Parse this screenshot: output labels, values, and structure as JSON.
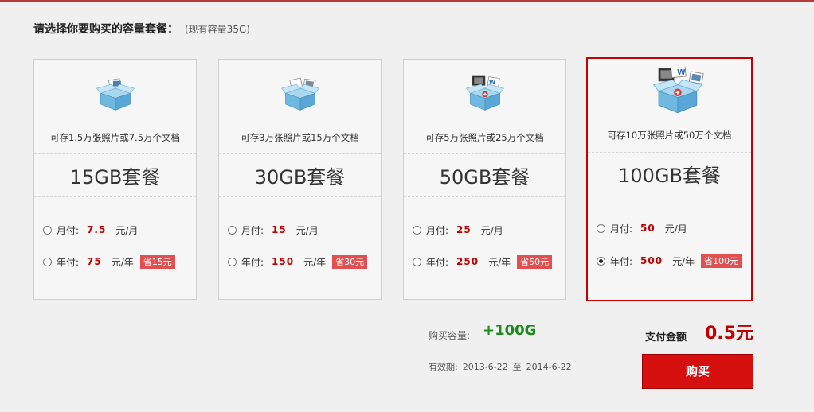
{
  "header": {
    "title": "请选择你要购买的容量套餐：",
    "current": "(现有容量35G)"
  },
  "plans": [
    {
      "icon": "box-photo-icon",
      "capacity_text": "可存1.5万张照片或7.5万个文档",
      "name": "15GB套餐",
      "monthly_label": "月付:",
      "monthly_price": "7.5",
      "monthly_unit": "元/月",
      "yearly_label": "年付:",
      "yearly_price": "75",
      "yearly_unit": "元/年",
      "saving": "省15元",
      "selected": false
    },
    {
      "icon": "box-photos-icon",
      "capacity_text": "可存3万张照片或15万个文档",
      "name": "30GB套餐",
      "monthly_label": "月付:",
      "monthly_price": "15",
      "monthly_unit": "元/月",
      "yearly_label": "年付:",
      "yearly_price": "150",
      "yearly_unit": "元/年",
      "saving": "省30元",
      "selected": false
    },
    {
      "icon": "box-media-icon",
      "capacity_text": "可存5万张照片或25万个文档",
      "name": "50GB套餐",
      "monthly_label": "月付:",
      "monthly_price": "25",
      "monthly_unit": "元/月",
      "yearly_label": "年付:",
      "yearly_price": "250",
      "yearly_unit": "元/年",
      "saving": "省50元",
      "selected": false
    },
    {
      "icon": "box-full-icon",
      "capacity_text": "可存10万张照片或50万个文档",
      "name": "100GB套餐",
      "monthly_label": "月付:",
      "monthly_price": "50",
      "monthly_unit": "元/月",
      "yearly_label": "年付:",
      "yearly_price": "500",
      "yearly_unit": "元/年",
      "saving": "省100元",
      "selected": true
    }
  ],
  "summary": {
    "capacity_label": "购买容量:",
    "capacity_value": "+100G",
    "validity_label": "有效期:",
    "validity_start": "2013-6-22",
    "validity_to": "至",
    "validity_end": "2014-6-22",
    "pay_label": "支付金额",
    "pay_value": "0.5元",
    "buy_label": "购买"
  },
  "colors": {
    "accent": "#c00000",
    "saving_bg": "#e05050",
    "capacity_green": "#1e8a1e",
    "button": "#d60f0f"
  }
}
